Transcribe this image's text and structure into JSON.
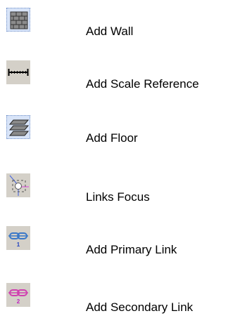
{
  "tools": [
    {
      "label": "Add Wall",
      "icon": "brick-wall-icon",
      "state": "active"
    },
    {
      "label": "Add Scale Reference",
      "icon": "scale-ruler-icon",
      "state": "normal"
    },
    {
      "label": "Add Floor",
      "icon": "floor-layers-icon",
      "state": "active"
    },
    {
      "label": "Links Focus",
      "icon": "links-focus-icon",
      "state": "normal"
    },
    {
      "label": "Add Primary Link",
      "icon": "primary-link-chain-icon",
      "badge": "1",
      "state": "normal"
    },
    {
      "label": "Add Secondary Link",
      "icon": "secondary-link-chain-icon",
      "badge": "2",
      "state": "normal"
    }
  ],
  "colors": {
    "button_face": "#d4d0c8",
    "active_face": "#d8e4f8",
    "primary_link": "#3a78c8",
    "secondary_link": "#d040b0",
    "focus_line_magenta": "#e040e0",
    "focus_line_blue": "#4060e0"
  }
}
